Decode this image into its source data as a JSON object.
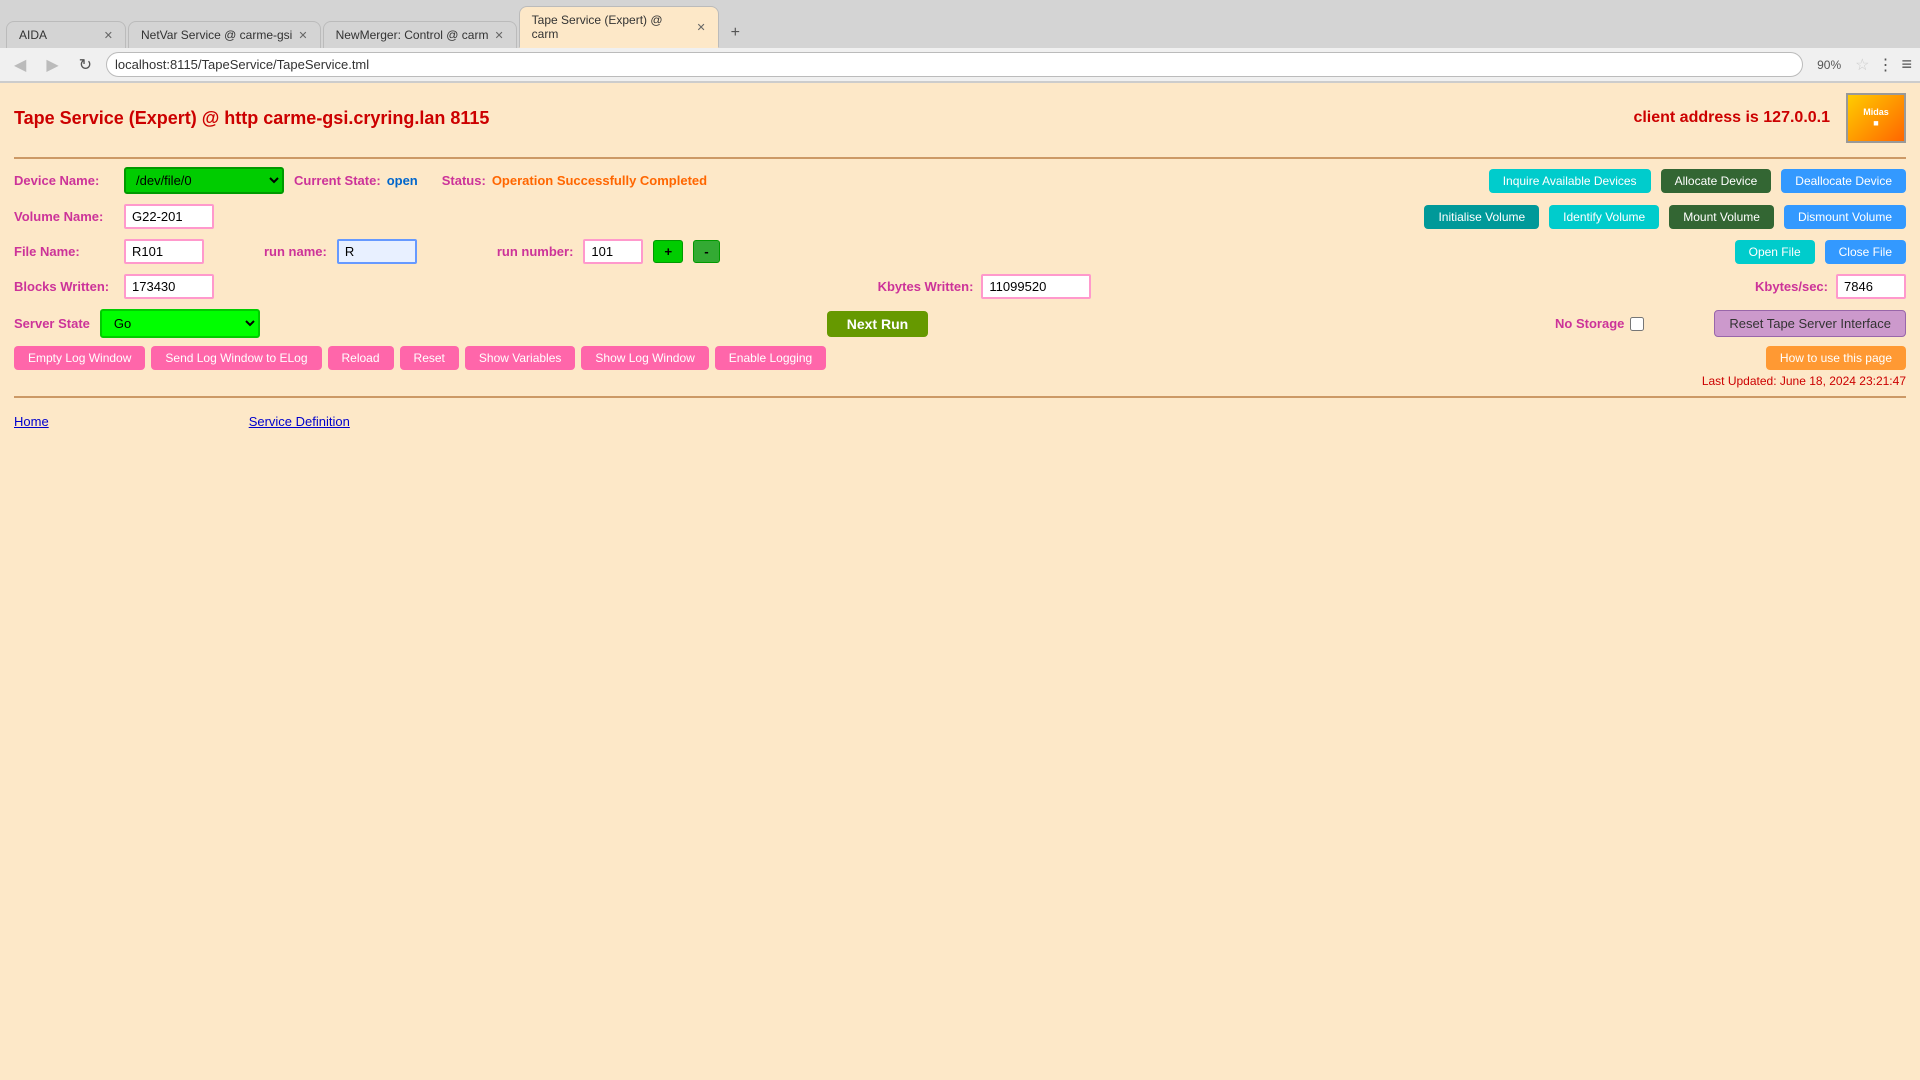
{
  "browser": {
    "tabs": [
      {
        "id": "aida",
        "label": "AIDA",
        "active": false
      },
      {
        "id": "netvar",
        "label": "NetVar Service @ carme-gsi",
        "active": false
      },
      {
        "id": "newmerger",
        "label": "NewMerger: Control @ carm",
        "active": false
      },
      {
        "id": "tapeservice",
        "label": "Tape Service (Expert) @ carm",
        "active": true
      }
    ],
    "url": "localhost:8115/TapeService/TapeService.tml",
    "zoom": "90%"
  },
  "page": {
    "title": "Tape Service (Expert) @ http carme-gsi.cryring.lan 8115",
    "client_address_label": "client address is 127.0.0.1",
    "device_name_label": "Device Name:",
    "device_value": "/dev/file/0",
    "current_state_label": "Current State:",
    "current_state_value": "open",
    "status_label": "Status:",
    "status_value": "Operation Successfully Completed",
    "volume_name_label": "Volume Name:",
    "volume_name_value": "G22-201",
    "file_name_label": "File Name:",
    "file_name_value": "R101",
    "run_name_label": "run name:",
    "run_name_value": "R",
    "run_number_label": "run number:",
    "run_number_value": "101",
    "blocks_written_label": "Blocks Written:",
    "blocks_written_value": "173430",
    "kbytes_written_label": "Kbytes Written:",
    "kbytes_written_value": "11099520",
    "kbytes_sec_label": "Kbytes/sec:",
    "kbytes_sec_value": "7846",
    "server_state_label": "Server State",
    "server_state_value": "Go",
    "no_storage_label": "No Storage",
    "buttons": {
      "inquire": "Inquire Available Devices",
      "allocate": "Allocate Device",
      "deallocate": "Deallocate Device",
      "initialise": "Initialise Volume",
      "identify": "Identify Volume",
      "mount": "Mount Volume",
      "dismount": "Dismount Volume",
      "open_file": "Open File",
      "close_file": "Close File",
      "next_run": "Next Run",
      "plus": "+",
      "minus": "-",
      "reset_tape": "Reset Tape Server Interface",
      "empty_log": "Empty Log Window",
      "send_log": "Send Log Window to ELog",
      "reload": "Reload",
      "reset": "Reset",
      "show_variables": "Show Variables",
      "show_log": "Show Log Window",
      "enable_logging": "Enable Logging",
      "how_to_use": "How to use this page"
    },
    "last_updated": "Last Updated: June 18, 2024 23:21:47",
    "footer": {
      "home": "Home",
      "service_definition": "Service Definition"
    }
  }
}
